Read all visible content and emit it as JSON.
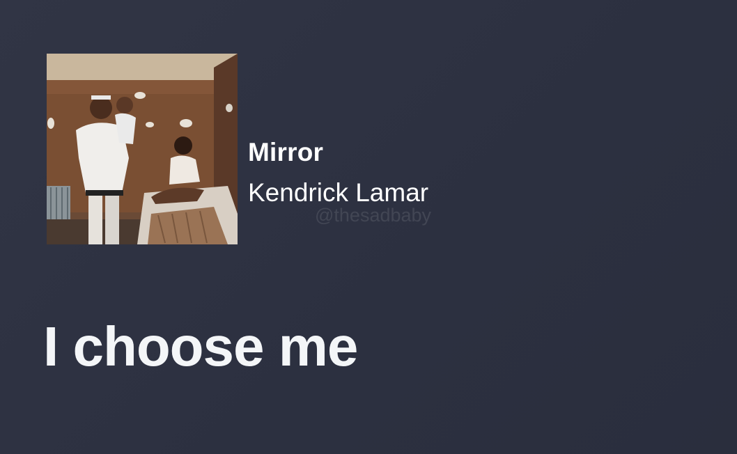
{
  "track": {
    "title": "Mirror",
    "artist": "Kendrick Lamar"
  },
  "watermark": "@thesadbaby",
  "lyric": {
    "line": "I choose me"
  },
  "colors": {
    "background": "#2f3342",
    "text": "#ffffff"
  },
  "cover_art": {
    "description_icon": "album-cover-image"
  }
}
